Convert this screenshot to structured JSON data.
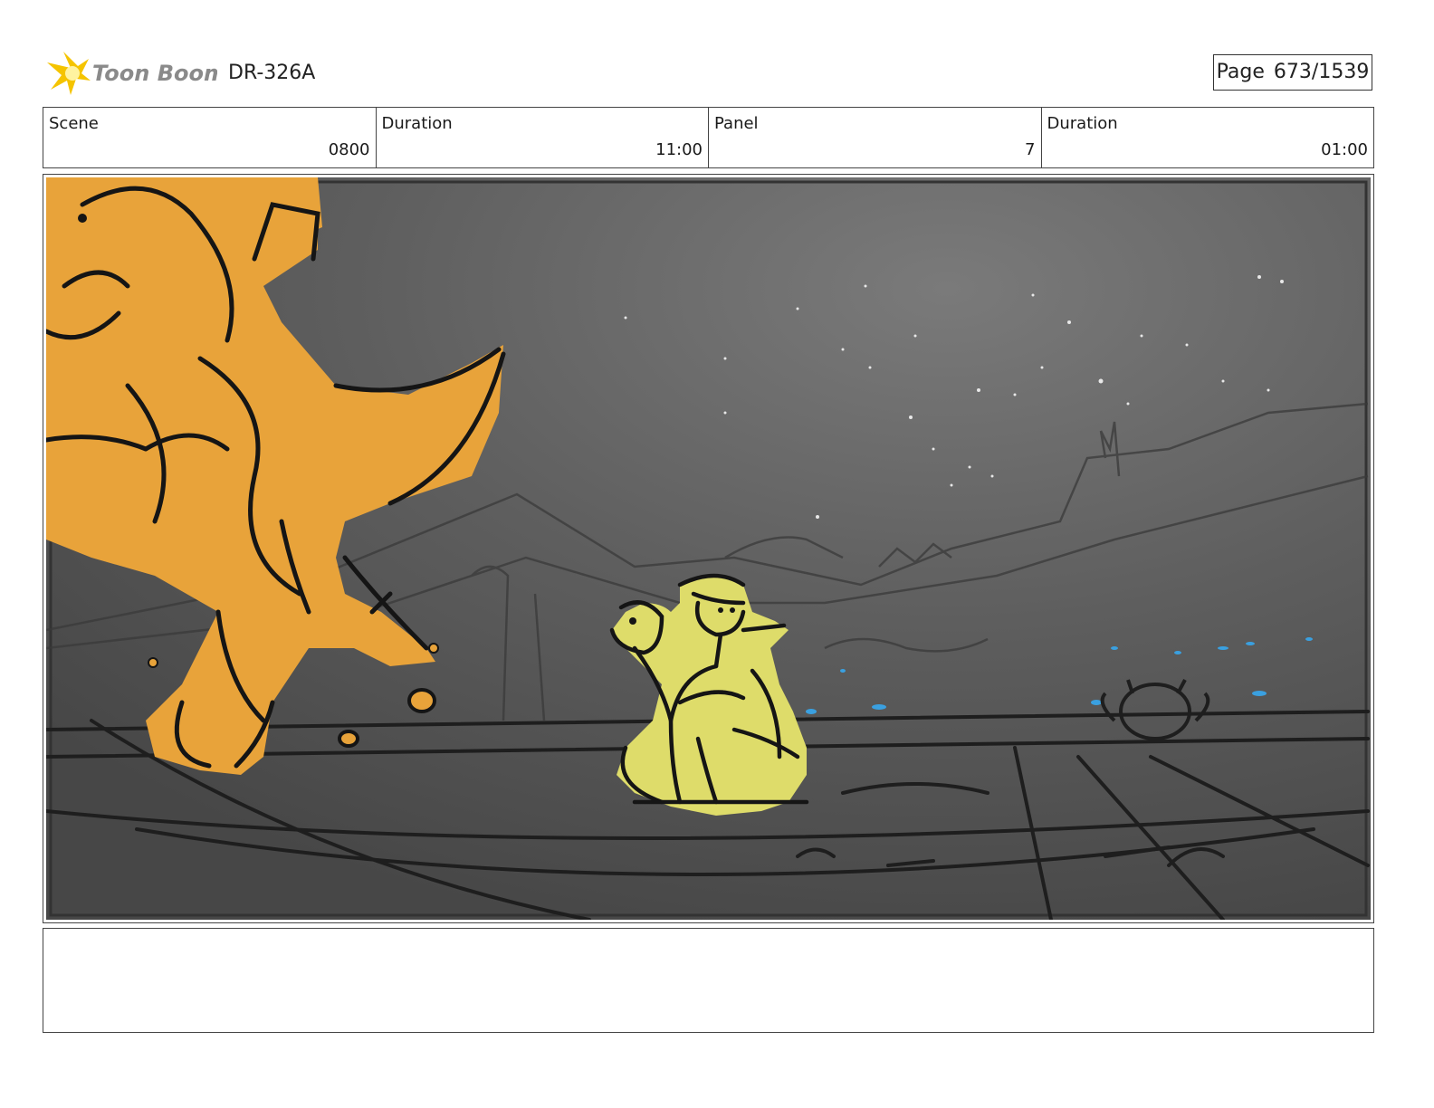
{
  "header": {
    "logo_text": "Toon Boom",
    "project_code": "DR-326A",
    "page_label": "Page",
    "page_value": "673/1539"
  },
  "info": {
    "scene_label": "Scene",
    "scene_value": "0800",
    "scene_duration_label": "Duration",
    "scene_duration_value": "11:00",
    "panel_label": "Panel",
    "panel_value": "7",
    "panel_duration_label": "Duration",
    "panel_duration_value": "01:00"
  },
  "colors": {
    "logo_yellow": "#f5c400",
    "logo_text": "#8a8a8a",
    "dino_orange": "#e8a33a",
    "dino_yellow": "#dedc6a",
    "sky_gray": "#5e5e5e",
    "water_blue": "#3aa0e0"
  },
  "notes": {
    "text": ""
  }
}
